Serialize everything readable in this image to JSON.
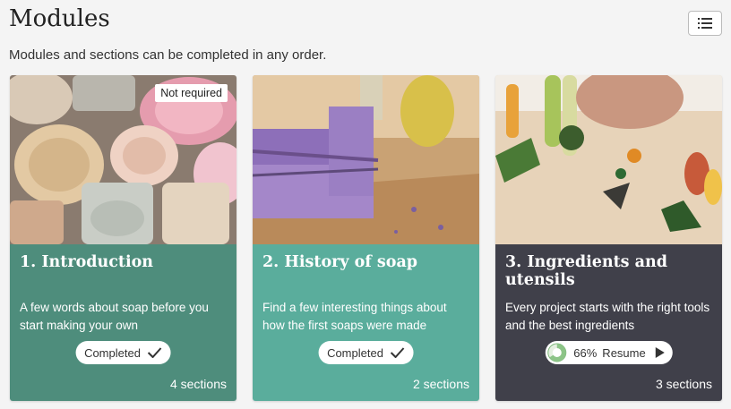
{
  "header": {
    "title": "Modules",
    "subtitle": "Modules and sections can be completed in any order."
  },
  "icons": {
    "view_toggle": "list-icon"
  },
  "modules": [
    {
      "title": "1. Introduction",
      "description": "A few words about soap before you start making your own",
      "badge": "Not required",
      "status": "Completed",
      "status_icon": "checkmark-icon",
      "sections": "4 sections",
      "color": "#4e8d7c"
    },
    {
      "title": "2. History of soap",
      "description": "Find a few interesting things about how the first soaps were made",
      "status": "Completed",
      "status_icon": "checkmark-icon",
      "sections": "2 sections",
      "color": "#5aad9c"
    },
    {
      "title": "3. Ingredients and utensils",
      "description": "Every project starts with the right tools and the best ingredients",
      "progress_label": "66%",
      "progress": 0.66,
      "action": "Resume",
      "action_icon": "play-icon",
      "sections": "3 sections",
      "color": "#40404a"
    }
  ]
}
